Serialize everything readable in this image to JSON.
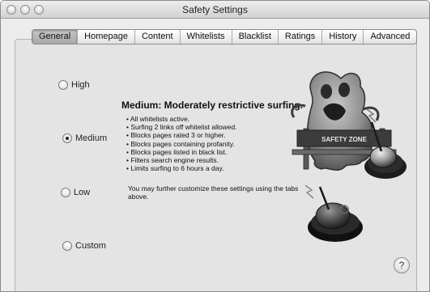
{
  "window": {
    "title": "Safety Settings"
  },
  "tabs": [
    {
      "label": "General",
      "selected": true
    },
    {
      "label": "Homepage",
      "selected": false
    },
    {
      "label": "Content",
      "selected": false
    },
    {
      "label": "Whitelists",
      "selected": false
    },
    {
      "label": "Blacklist",
      "selected": false
    },
    {
      "label": "Ratings",
      "selected": false
    },
    {
      "label": "History",
      "selected": false
    },
    {
      "label": "Advanced",
      "selected": false
    }
  ],
  "levels": [
    {
      "label": "High",
      "checked": false
    },
    {
      "label": "Medium",
      "checked": true
    },
    {
      "label": "Low",
      "checked": false
    },
    {
      "label": "Custom",
      "checked": false
    }
  ],
  "description": {
    "heading": "Medium: Moderately restrictive surfing.",
    "bullets": [
      "All whitelists active.",
      "Surfing 2 links off whitelist allowed.",
      "Blocks pages rated 3 or higher.",
      "Blocks pages containing profanity.",
      "Blocks pages listed in black list.",
      "Filters search engine results.",
      "Limits surfing to 6 hours a day."
    ],
    "note": "You may further customize these settings using the tabs above."
  },
  "illustration": {
    "sign_text": "SAFETY ZONE"
  },
  "help": {
    "label": "?"
  },
  "colors": {
    "window_bg": "#e9e9e9",
    "panel_bg": "#e4e4e4",
    "selected_tab": "#b3b3b3"
  }
}
